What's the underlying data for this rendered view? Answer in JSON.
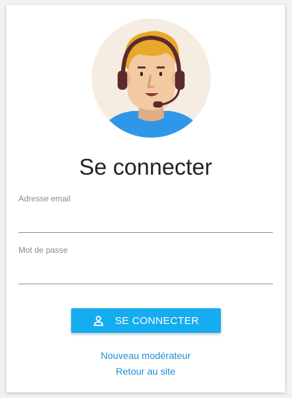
{
  "login": {
    "title": "Se connecter",
    "email_label": "Adresse email",
    "email_value": "",
    "password_label": "Mot de passe",
    "password_value": "",
    "submit_label": "SE CONNECTER",
    "new_moderator_link": "Nouveau modérateur",
    "back_link": "Retour au site"
  },
  "icons": {
    "avatar": "support-agent-headset-icon",
    "button": "person-icon"
  },
  "colors": {
    "accent": "#15acf0",
    "link": "#1f8fd6",
    "avatar_bg": "#f5ece2",
    "shirt": "#2f97e8",
    "hair": "#e8a92a"
  }
}
